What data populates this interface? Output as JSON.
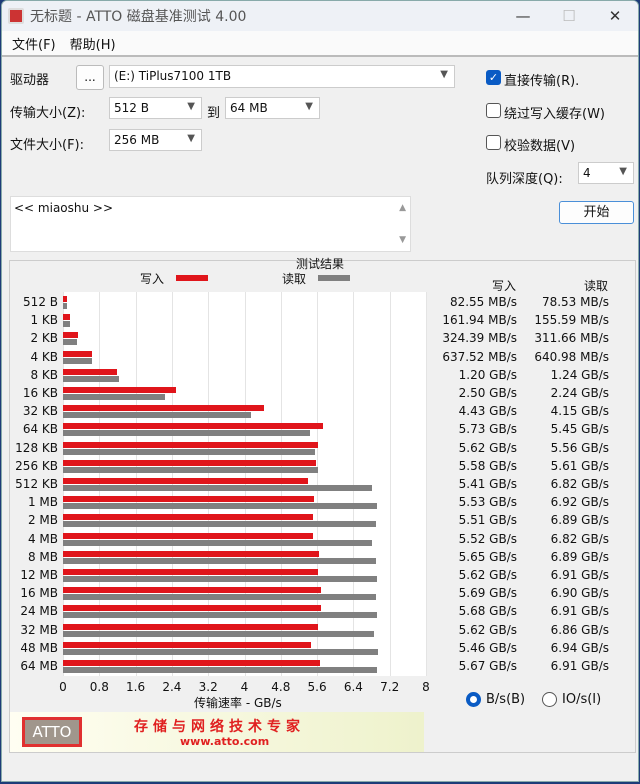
{
  "window": {
    "title": "无标题 - ATTO 磁盘基准测试 4.00",
    "minimize": "—",
    "maximize": "☐",
    "close": "✕"
  },
  "menu": [
    "文件(F)",
    "帮助(H)"
  ],
  "controls": {
    "drive_label": "驱动器",
    "browse": "...",
    "drive_value": "(E:) TiPlus7100 1TB",
    "transfer_label": "传输大小(Z):",
    "transfer_from": "512 B",
    "to_label": "到",
    "transfer_to": "64 MB",
    "file_label": "文件大小(F):",
    "file_value": "256 MB",
    "direct_io": "直接传输(R).",
    "direct_io_checked": true,
    "bypass_cache": "绕过写入缓存(W)",
    "bypass_checked": false,
    "verify": "校验数据(V)",
    "verify_checked": false,
    "queue_label": "队列深度(Q):",
    "queue_value": "4",
    "start": "开始",
    "description": "<< miaoshu >>"
  },
  "results": {
    "title": "测试结果",
    "write_header": "写入",
    "read_header": "读取",
    "legend_write": "写入",
    "legend_read": "读取",
    "unit_bytes": "B/s(B)",
    "unit_io": "IO/s(I)",
    "unit_selected": "B/s"
  },
  "banner": {
    "logo": "ATTO",
    "slogan": "存储与网络技术专家",
    "url": "www.atto.com"
  },
  "chart_data": {
    "type": "bar",
    "orientation": "horizontal",
    "xlabel": "传输速率 - GB/s",
    "xlim": [
      0,
      8
    ],
    "xticks": [
      "0",
      "0.8",
      "1.6",
      "2.4",
      "3.2",
      "4",
      "4.8",
      "5.6",
      "6.4",
      "7.2",
      "8"
    ],
    "categories": [
      "512 B",
      "1 KB",
      "2 KB",
      "4 KB",
      "8 KB",
      "16 KB",
      "32 KB",
      "64 KB",
      "128 KB",
      "256 KB",
      "512 KB",
      "1 MB",
      "2 MB",
      "4 MB",
      "8 MB",
      "12 MB",
      "16 MB",
      "24 MB",
      "32 MB",
      "48 MB",
      "64 MB"
    ],
    "series": [
      {
        "name": "写入",
        "color": "#e0151b",
        "values": [
          0.08255,
          0.16194,
          0.32439,
          0.63752,
          1.2,
          2.5,
          4.43,
          5.73,
          5.62,
          5.58,
          5.41,
          5.53,
          5.51,
          5.52,
          5.65,
          5.62,
          5.69,
          5.68,
          5.62,
          5.46,
          5.67
        ],
        "labels": [
          "82.55 MB/s",
          "161.94 MB/s",
          "324.39 MB/s",
          "637.52 MB/s",
          "1.20 GB/s",
          "2.50 GB/s",
          "4.43 GB/s",
          "5.73 GB/s",
          "5.62 GB/s",
          "5.58 GB/s",
          "5.41 GB/s",
          "5.53 GB/s",
          "5.51 GB/s",
          "5.52 GB/s",
          "5.65 GB/s",
          "5.62 GB/s",
          "5.69 GB/s",
          "5.68 GB/s",
          "5.62 GB/s",
          "5.46 GB/s",
          "5.67 GB/s"
        ]
      },
      {
        "name": "读取",
        "color": "#808080",
        "values": [
          0.07853,
          0.15559,
          0.31166,
          0.64098,
          1.24,
          2.24,
          4.15,
          5.45,
          5.56,
          5.61,
          6.82,
          6.92,
          6.89,
          6.82,
          6.89,
          6.91,
          6.9,
          6.91,
          6.86,
          6.94,
          6.91
        ],
        "labels": [
          "78.53 MB/s",
          "155.59 MB/s",
          "311.66 MB/s",
          "640.98 MB/s",
          "1.24 GB/s",
          "2.24 GB/s",
          "4.15 GB/s",
          "5.45 GB/s",
          "5.56 GB/s",
          "5.61 GB/s",
          "6.82 GB/s",
          "6.92 GB/s",
          "6.89 GB/s",
          "6.82 GB/s",
          "6.89 GB/s",
          "6.91 GB/s",
          "6.90 GB/s",
          "6.91 GB/s",
          "6.86 GB/s",
          "6.94 GB/s",
          "6.91 GB/s"
        ]
      }
    ]
  }
}
